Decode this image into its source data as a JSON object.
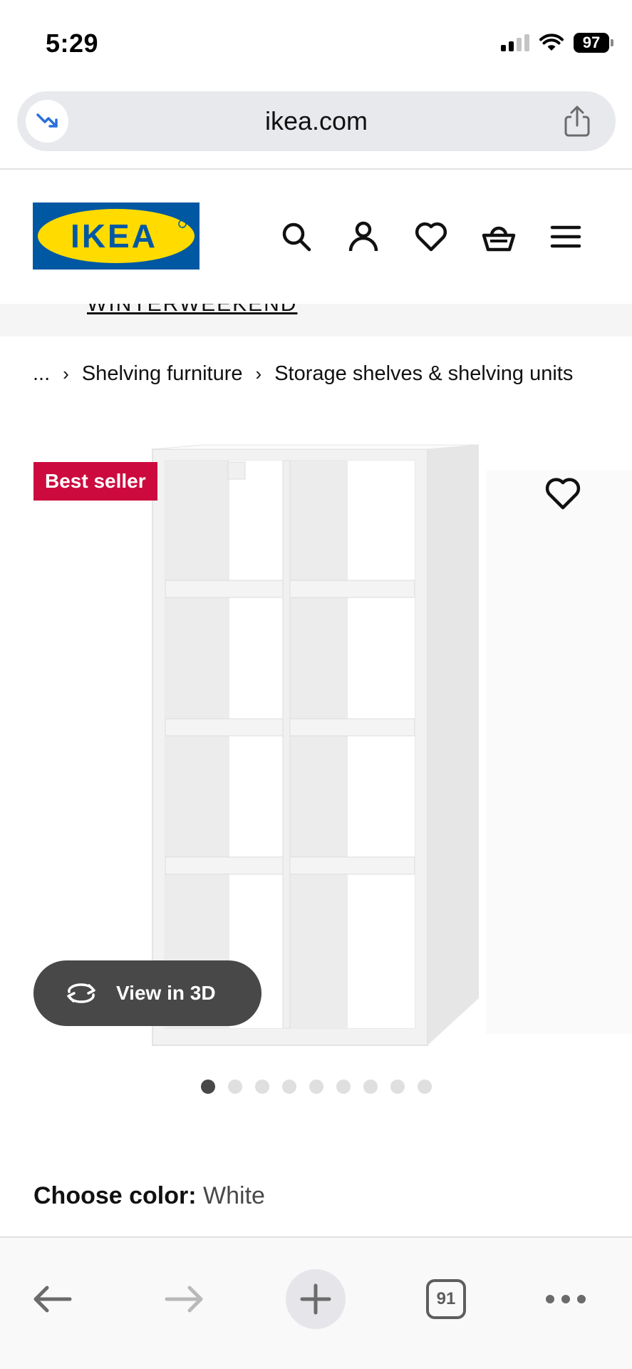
{
  "status_bar": {
    "time": "5:29",
    "battery": "97"
  },
  "browser": {
    "url": "ikea.com",
    "tabs_count": "91"
  },
  "header": {
    "logo_text": "IKEA"
  },
  "banner": {
    "text": "WINTERWEEKEND"
  },
  "breadcrumb": {
    "items": [
      "...",
      "Shelving furniture",
      "Storage shelves & shelving units"
    ],
    "separator": "›"
  },
  "product": {
    "badge": "Best seller",
    "view_3d_label": "View in 3D",
    "image_count": 9,
    "active_image_index": 0
  },
  "color_selector": {
    "label": "Choose color:",
    "value": "White"
  },
  "colors": {
    "ikea_blue": "#0058a3",
    "ikea_yellow": "#ffdb00",
    "badge_red": "#cc0a3e",
    "dark_button": "#484848"
  },
  "icons": [
    "trend-icon",
    "share-icon",
    "search-icon",
    "account-icon",
    "heart-icon",
    "basket-icon",
    "menu-icon",
    "rotate-3d-icon",
    "back-arrow-icon",
    "forward-arrow-icon",
    "plus-icon",
    "tabs-icon",
    "more-icon"
  ]
}
